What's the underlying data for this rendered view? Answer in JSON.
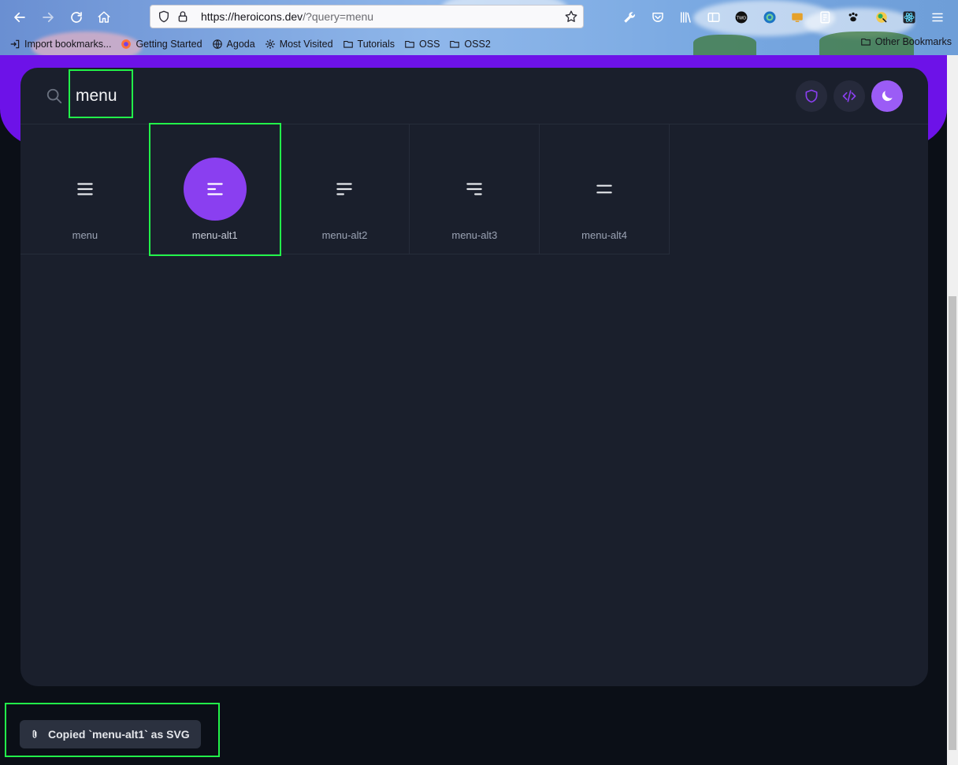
{
  "browser": {
    "url_host": "https://heroicons.dev",
    "url_rest": "/?query=menu",
    "bookmarks": [
      {
        "label": "Import bookmarks...",
        "icon": "import-icon"
      },
      {
        "label": "Getting Started",
        "icon": "firefox-icon"
      },
      {
        "label": "Agoda",
        "icon": "globe-icon"
      },
      {
        "label": "Most Visited",
        "icon": "gear-icon"
      },
      {
        "label": "Tutorials",
        "icon": "folder-icon"
      },
      {
        "label": "OSS",
        "icon": "folder-icon"
      },
      {
        "label": "OSS2",
        "icon": "folder-icon"
      }
    ],
    "other_bookmarks": "Other Bookmarks"
  },
  "search": {
    "value": "menu"
  },
  "icons": [
    {
      "name": "menu",
      "selected": false
    },
    {
      "name": "menu-alt1",
      "selected": true
    },
    {
      "name": "menu-alt2",
      "selected": false
    },
    {
      "name": "menu-alt3",
      "selected": false
    },
    {
      "name": "menu-alt4",
      "selected": false
    }
  ],
  "toast": {
    "text": "Copied `menu-alt1` as SVG",
    "icon": "paperclip-icon"
  },
  "colors": {
    "accent": "#8a3ff0",
    "band": "#6d12e8",
    "card": "#1a1f2c",
    "highlight": "#22f34a"
  }
}
